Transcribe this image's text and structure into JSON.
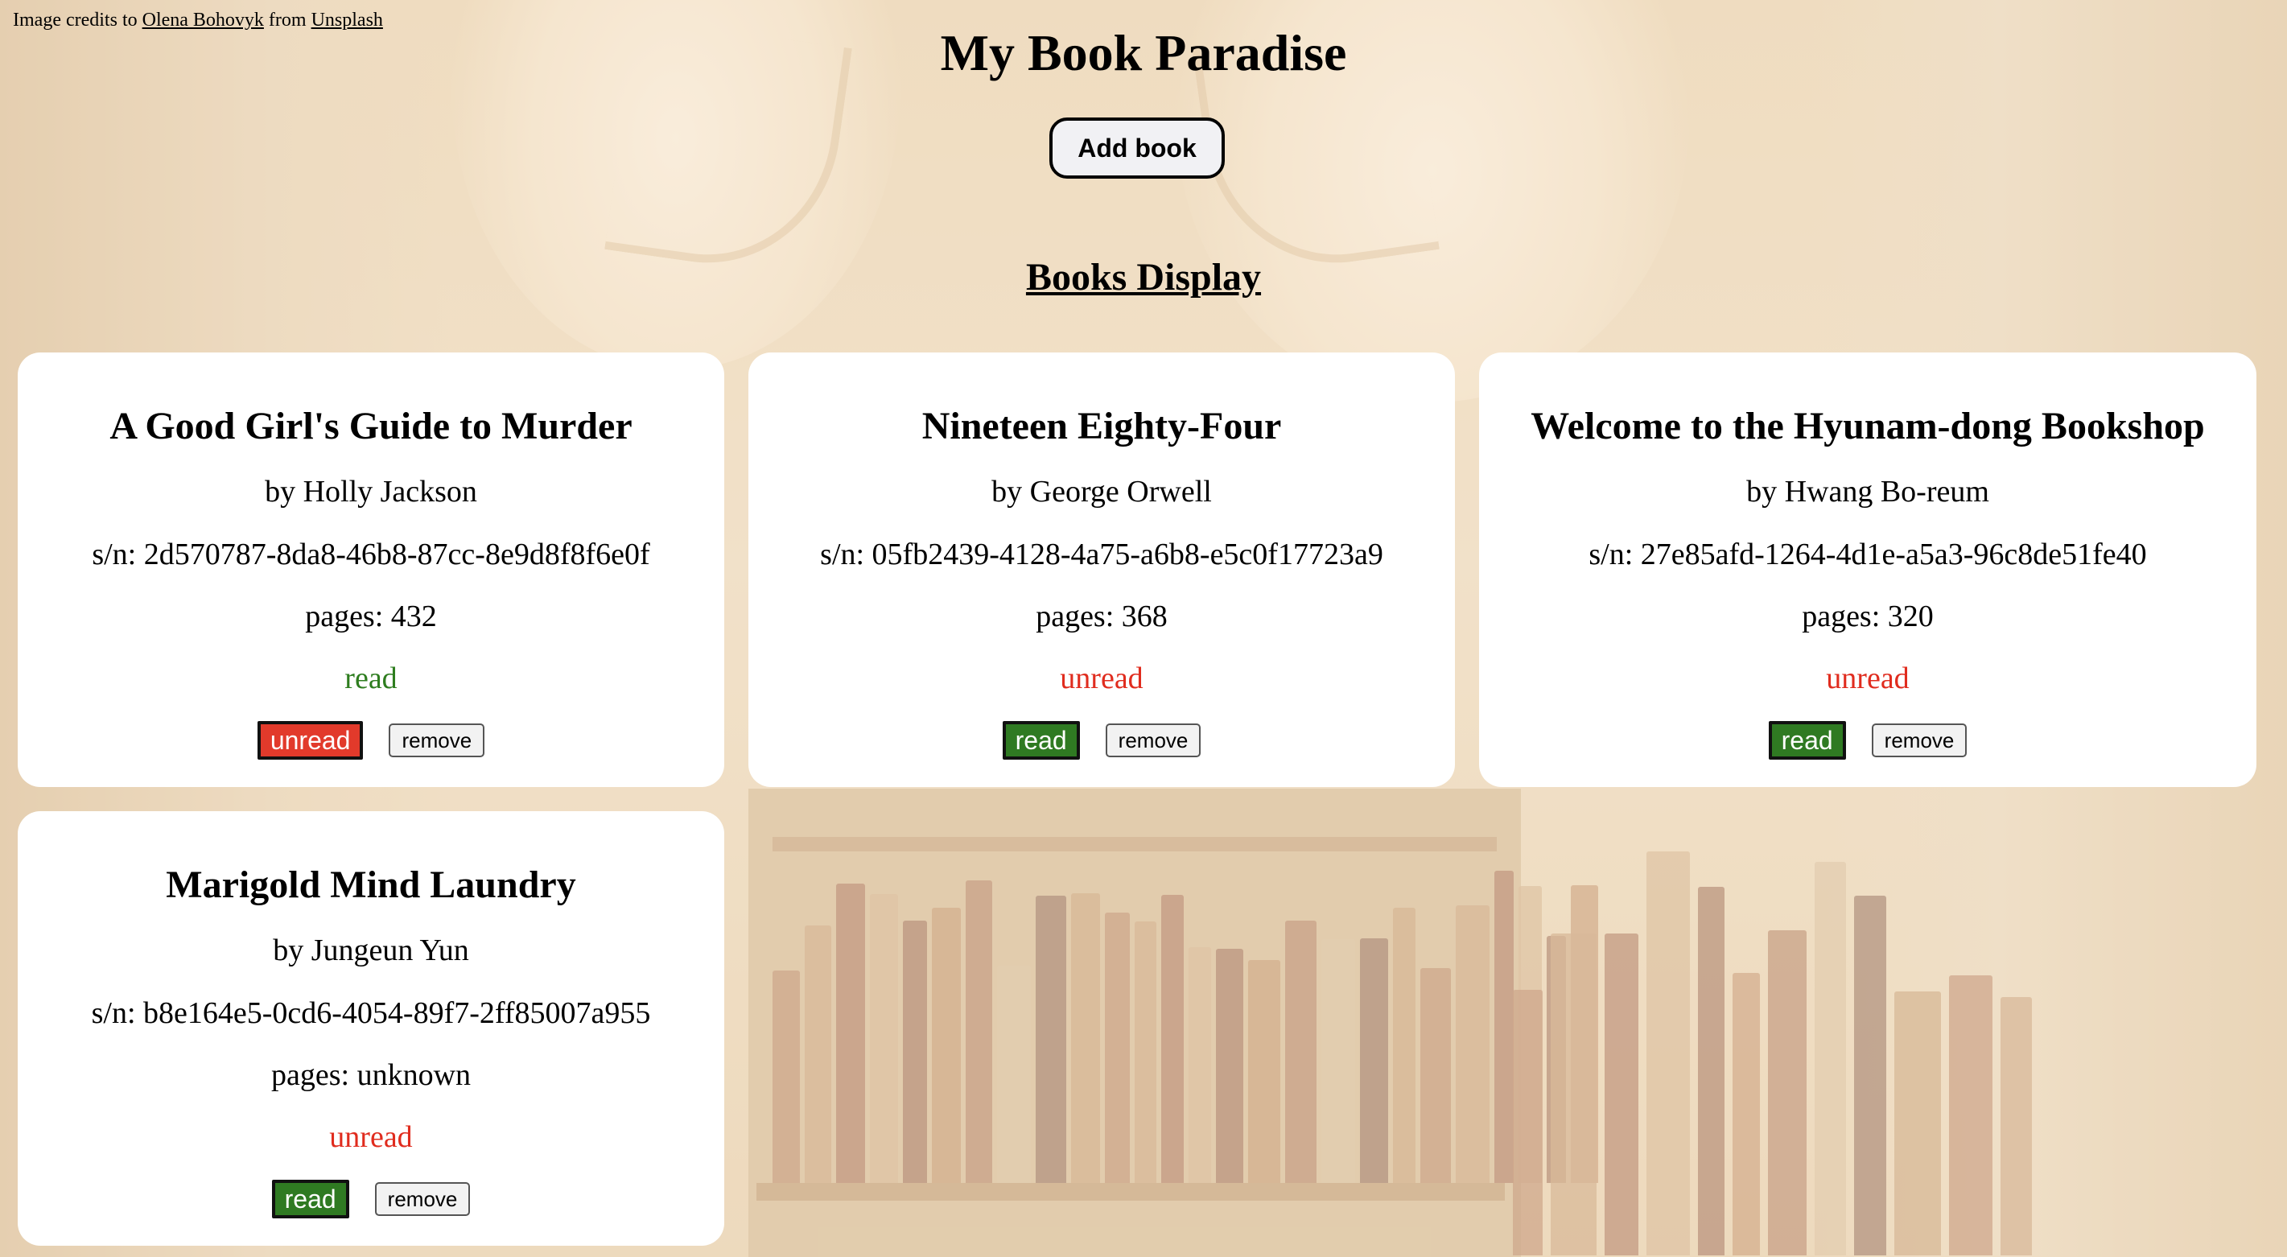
{
  "credits": {
    "prefix": "Image credits to",
    "author": "Olena Bohovyk",
    "middle": "from",
    "source": "Unsplash"
  },
  "header": {
    "title": "My Book Paradise",
    "add_button": "Add book"
  },
  "section": {
    "title": "Books Display"
  },
  "books": [
    {
      "title": "A Good Girl's Guide to Murder",
      "author": "by Holly Jackson",
      "serial": "s/n: 2d570787-8da8-46b8-87cc-8e9d8f8f6e0f",
      "pages": "pages: 432",
      "status": "read",
      "toggle_label": "unread",
      "remove_label": "remove"
    },
    {
      "title": "Nineteen Eighty-Four",
      "author": "by George Orwell",
      "serial": "s/n: 05fb2439-4128-4a75-a6b8-e5c0f17723a9",
      "pages": "pages: 368",
      "status": "unread",
      "toggle_label": "read",
      "remove_label": "remove"
    },
    {
      "title": "Welcome to the Hyunam-dong Bookshop",
      "author": "by Hwang Bo-reum",
      "serial": "s/n: 27e85afd-1264-4d1e-a5a3-96c8de51fe40",
      "pages": "pages: 320",
      "status": "unread",
      "toggle_label": "read",
      "remove_label": "remove"
    },
    {
      "title": "Marigold Mind Laundry",
      "author": "by Jungeun Yun",
      "serial": "s/n: b8e164e5-0cd6-4054-89f7-2ff85007a955",
      "pages": "pages: unknown",
      "status": "unread",
      "toggle_label": "read",
      "remove_label": "remove"
    }
  ],
  "colors": {
    "read": "#2e7d1f",
    "unread": "#e02c1e",
    "read_button": "#2f7a22",
    "unread_button": "#e23a2b",
    "card_background": "#ffffff"
  }
}
